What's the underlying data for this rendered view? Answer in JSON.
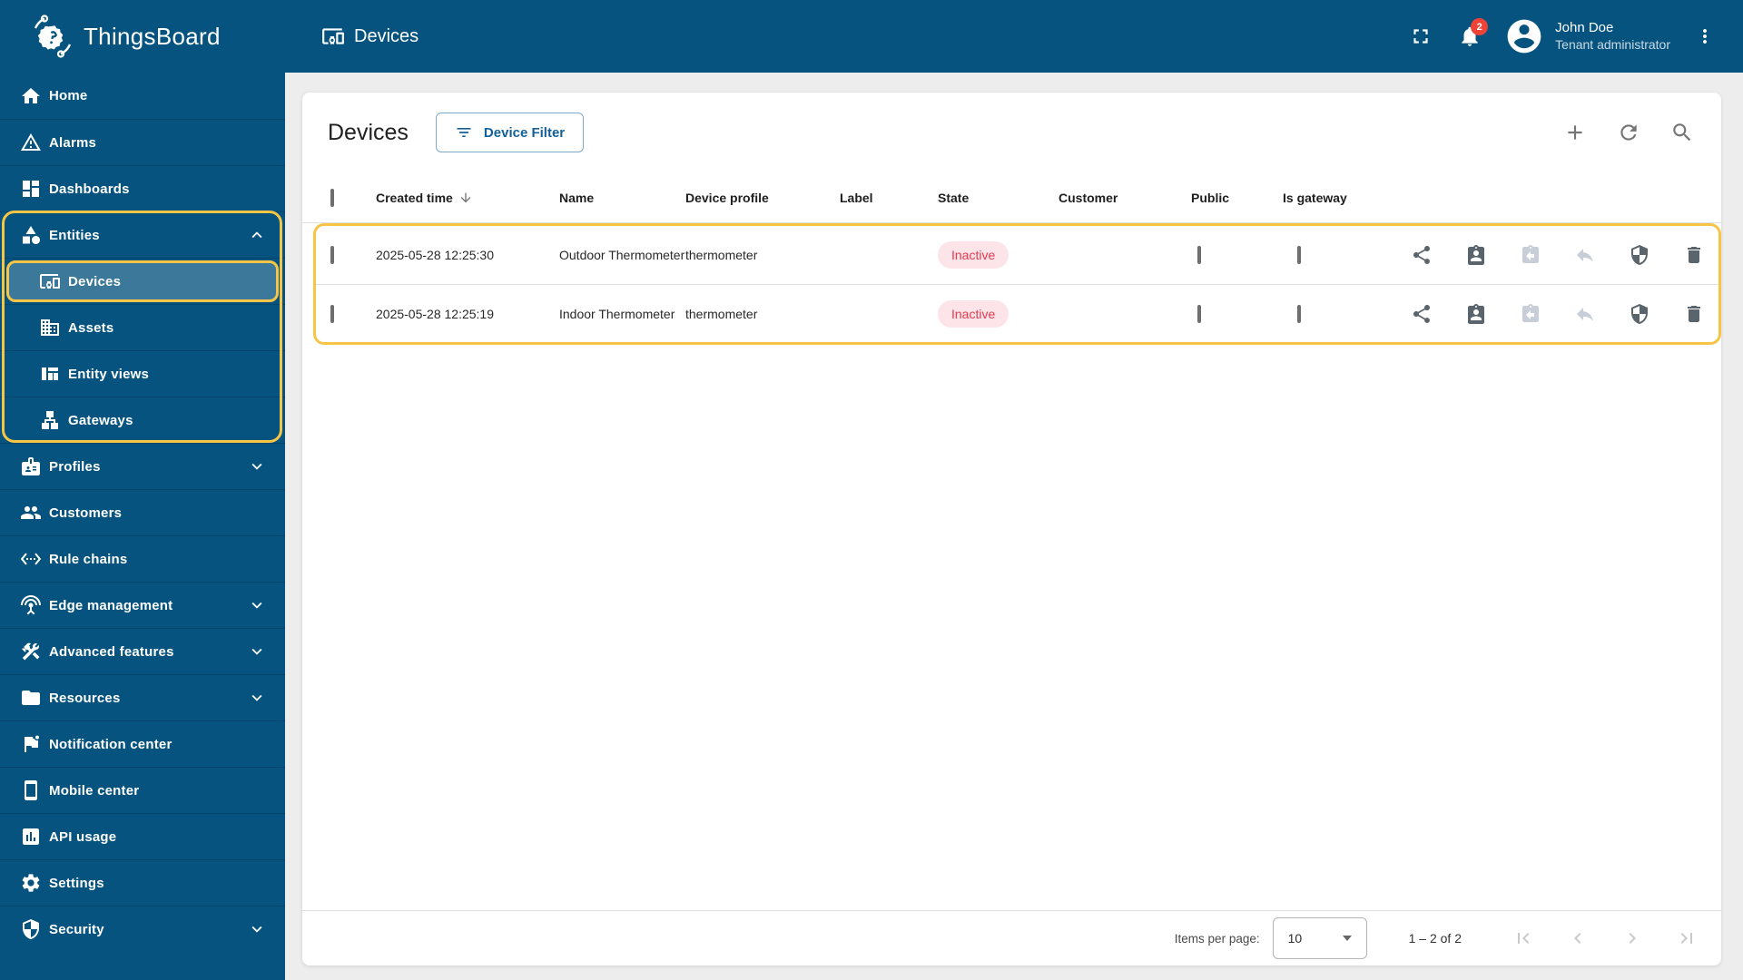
{
  "app": {
    "name": "ThingsBoard"
  },
  "header": {
    "breadcrumb": "Devices",
    "notifications_count": "2",
    "user": {
      "name": "John Doe",
      "role": "Tenant administrator"
    }
  },
  "sidebar": {
    "items": [
      {
        "label": "Home"
      },
      {
        "label": "Alarms"
      },
      {
        "label": "Dashboards"
      },
      {
        "label": "Entities"
      },
      {
        "label": "Devices"
      },
      {
        "label": "Assets"
      },
      {
        "label": "Entity views"
      },
      {
        "label": "Gateways"
      },
      {
        "label": "Profiles"
      },
      {
        "label": "Customers"
      },
      {
        "label": "Rule chains"
      },
      {
        "label": "Edge management"
      },
      {
        "label": "Advanced features"
      },
      {
        "label": "Resources"
      },
      {
        "label": "Notification center"
      },
      {
        "label": "Mobile center"
      },
      {
        "label": "API usage"
      },
      {
        "label": "Settings"
      },
      {
        "label": "Security"
      }
    ],
    "selected_item": "Devices"
  },
  "page": {
    "title": "Devices",
    "filter_button_label": "Device Filter"
  },
  "table": {
    "columns": [
      "Created time",
      "Name",
      "Device profile",
      "Label",
      "State",
      "Customer",
      "Public",
      "Is gateway"
    ],
    "sorted_by": "Created time",
    "sort_direction": "desc",
    "rows": [
      {
        "created_time": "2025-05-28 12:25:30",
        "name": "Outdoor Thermometer",
        "device_profile": "thermometer",
        "label": "",
        "state": "Inactive",
        "customer": "",
        "public": false,
        "is_gateway": false
      },
      {
        "created_time": "2025-05-28 12:25:19",
        "name": "Indoor Thermometer",
        "device_profile": "thermometer",
        "label": "",
        "state": "Inactive",
        "customer": "",
        "public": false,
        "is_gateway": false
      }
    ],
    "row_actions": [
      "share",
      "assign-to-customer",
      "claim-device",
      "unassign",
      "manage-credentials",
      "delete"
    ]
  },
  "pagination": {
    "items_per_page_label": "Items per page:",
    "items_per_page": "10",
    "range": "1 – 2 of 2"
  },
  "colors": {
    "primary": "#05537E",
    "highlight": "#F7C545",
    "inactive_text": "#E23A50",
    "inactive_bg": "#FCE4E8",
    "notification_badge": "#EE4337"
  }
}
